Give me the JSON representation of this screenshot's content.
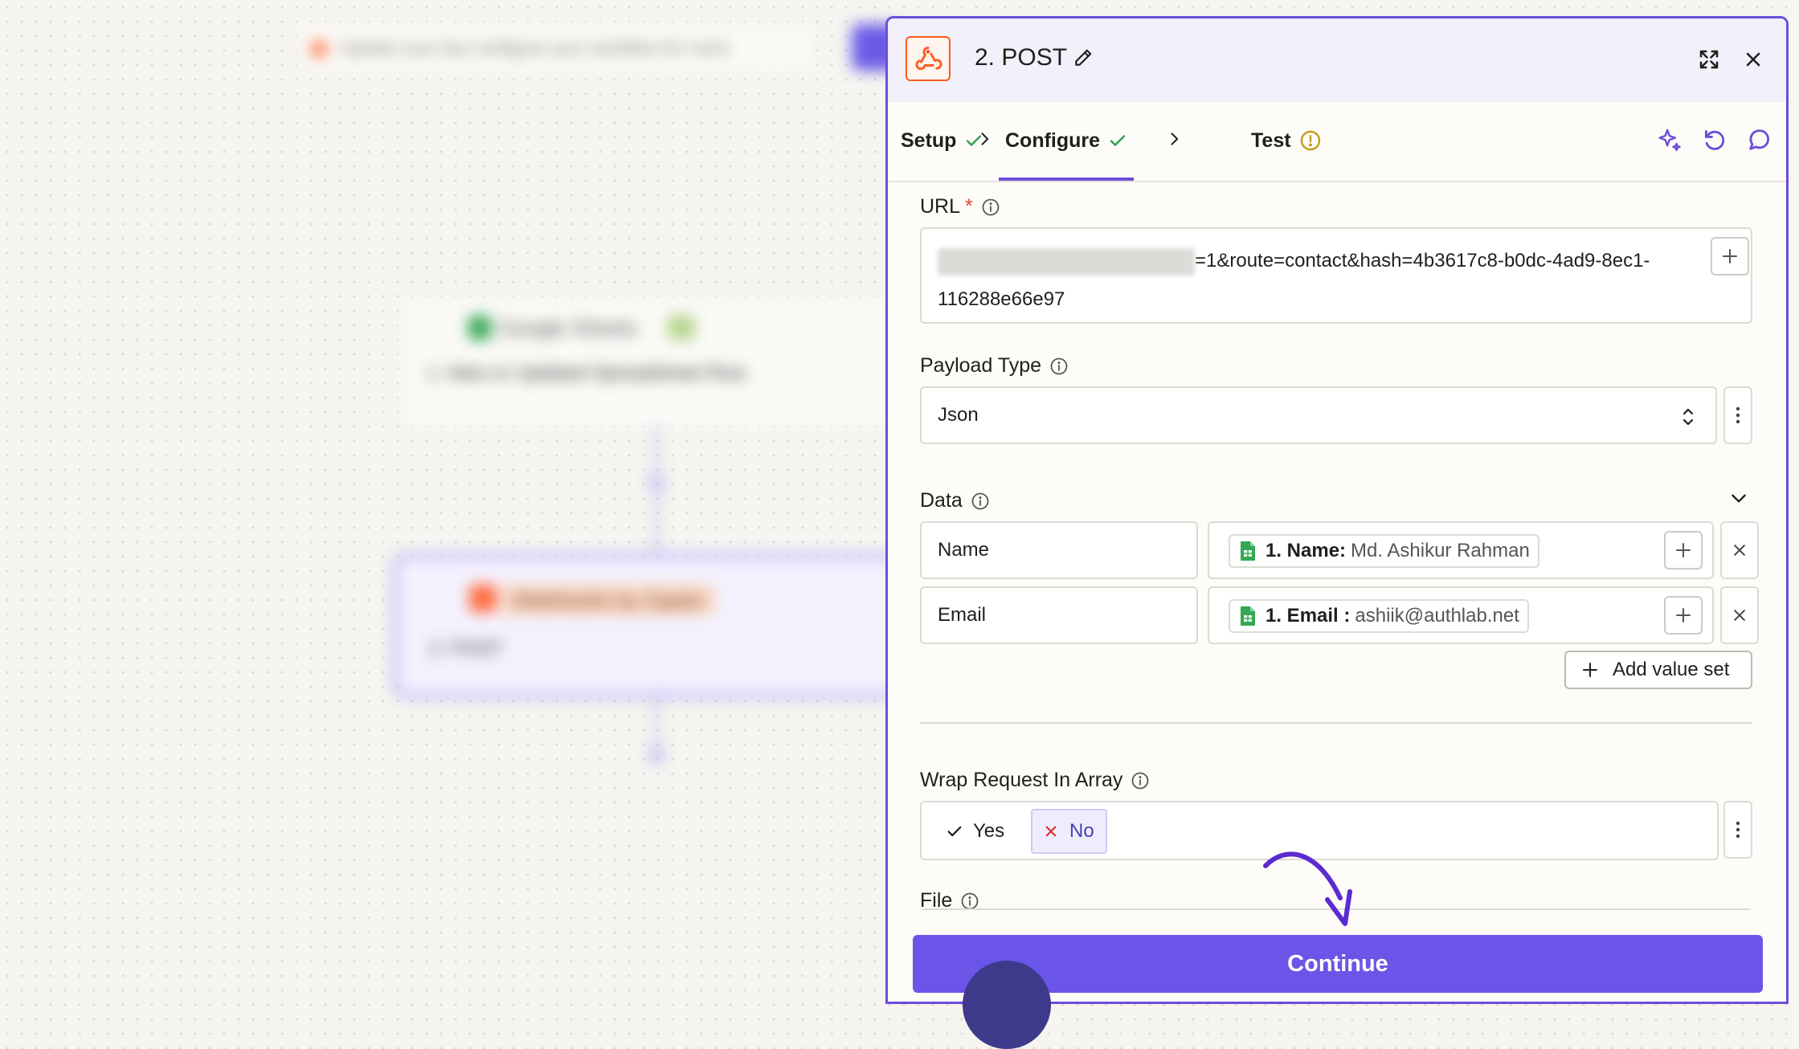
{
  "canvas": {
    "banner_text": "Update your key configure your workflow for more",
    "node1": {
      "title": "Google Sheets",
      "subtitle": "1. New or Updated Spreadsheet Row"
    },
    "node2": {
      "title": "Webhooks by Zapier",
      "subtitle": "2. POST"
    }
  },
  "panel": {
    "title": "2. POST",
    "tabs": [
      {
        "label": "Setup",
        "status": "complete"
      },
      {
        "label": "Configure",
        "status": "complete"
      },
      {
        "label": "Test",
        "status": "warning"
      }
    ],
    "url": {
      "label": "URL",
      "required_mark": "*",
      "value_visible": "=1&route=contact&hash=4b3617c8-b0dc-4ad9-8ec1-",
      "value_line2": "116288e66e97"
    },
    "payload_type": {
      "label": "Payload Type",
      "value": "Json"
    },
    "data": {
      "label": "Data",
      "rows": [
        {
          "key": "Name",
          "pill_key": "1. Name:",
          "pill_value": "Md. Ashikur Rahman"
        },
        {
          "key": "Email",
          "pill_key": "1. Email :",
          "pill_value": "ashiik@authlab.net"
        }
      ],
      "add_value_set": "Add value set"
    },
    "wrap_request": {
      "label": "Wrap Request In Array",
      "yes": "Yes",
      "no": "No",
      "selected": "No"
    },
    "file": {
      "label": "File"
    },
    "continue_label": "Continue"
  },
  "colors": {
    "accent": "#6b4fd8",
    "continue": "#6b55e8",
    "webhook_orange": "#ff5a1f",
    "success_green": "#2f9e57",
    "warning_amber": "#c79a10",
    "required_red": "#e2412f",
    "sheets_green": "#34a853"
  },
  "icons": {
    "app": "webhook-icon",
    "edit": "pencil-icon",
    "expand": "expand-icon",
    "close": "close-icon",
    "ai": "sparkle-icon",
    "undo": "undo-icon",
    "comment": "comment-icon",
    "sheets": "google-sheets-icon"
  }
}
